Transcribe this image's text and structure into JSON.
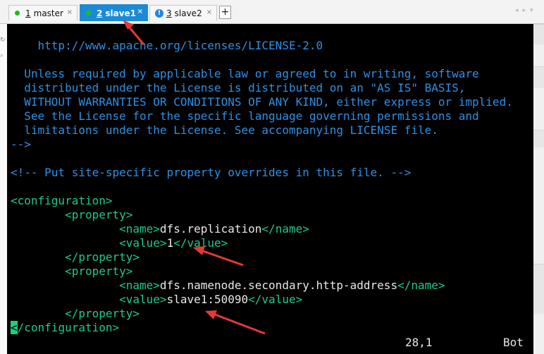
{
  "tabs": [
    {
      "num": "1",
      "label": "master",
      "status": "connected"
    },
    {
      "num": "2",
      "label": "slave1",
      "status": "connected",
      "active": true
    },
    {
      "num": "3",
      "label": "slave2",
      "status": "warning"
    }
  ],
  "tabbar": {
    "new_tab": "+",
    "close": "×",
    "warn_glyph": "!",
    "nav_arrows": "◂▸▾"
  },
  "terminal": {
    "lines": [
      "    http://www.apache.org/licenses/LICENSE-2.0",
      "",
      "  Unless required by applicable law or agreed to in writing, software",
      "  distributed under the License is distributed on an \"AS IS\" BASIS,",
      "  WITHOUT WARRANTIES OR CONDITIONS OF ANY KIND, either express or implied.",
      "  See the License for the specific language governing permissions and",
      "  limitations under the License. See accompanying LICENSE file.",
      "-->",
      "",
      "<!-- Put site-specific property overrides in this file. -->",
      "",
      "<configuration>"
    ],
    "xml": {
      "property_open": "<property>",
      "property_close": "</property>",
      "name_open": "<name>",
      "name_close": "</name>",
      "value_open": "<value>",
      "value_close": "</value>",
      "config_close_rest": "/configuration>",
      "config_close_cursor": "<"
    },
    "properties": [
      {
        "name": "dfs.replication",
        "value": "1"
      },
      {
        "name": "dfs.namenode.secondary.http-address",
        "value": "slave1:50090"
      }
    ],
    "status_position": "28,1",
    "status_scroll": "Bot"
  },
  "colors": {
    "comment": "#2f8fe3",
    "tag": "#1fc98e",
    "text": "#e8e8e8",
    "annotation_arrow": "#e53935",
    "active_tab": "#1c8bd6"
  }
}
